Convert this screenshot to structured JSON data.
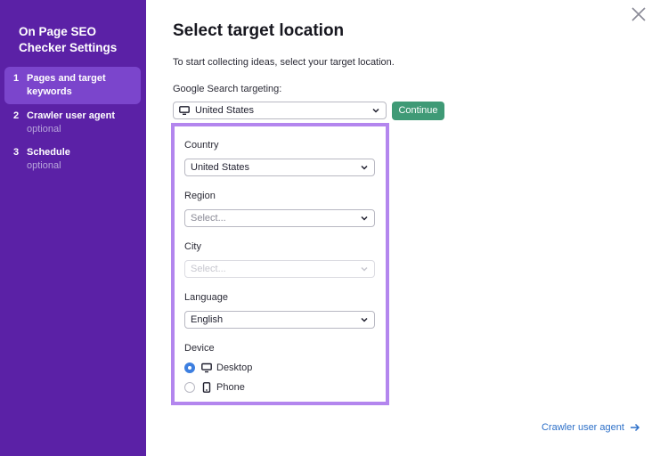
{
  "sidebar": {
    "title": "On Page SEO Checker Settings",
    "steps": [
      {
        "num": "1",
        "label": "Pages and target keywords",
        "sub": ""
      },
      {
        "num": "2",
        "label": "Crawler user agent",
        "sub": "optional"
      },
      {
        "num": "3",
        "label": "Schedule",
        "sub": "optional"
      }
    ]
  },
  "main": {
    "title": "Select target location",
    "subtitle": "To start collecting ideas, select your target location.",
    "targeting_label": "Google Search targeting:",
    "targeting_value": "United States",
    "continue_label": "Continue",
    "country": {
      "label": "Country",
      "value": "United States"
    },
    "region": {
      "label": "Region",
      "placeholder": "Select..."
    },
    "city": {
      "label": "City",
      "placeholder": "Select..."
    },
    "language": {
      "label": "Language",
      "value": "English"
    },
    "device": {
      "label": "Device",
      "options": [
        {
          "label": "Desktop",
          "selected": true,
          "icon": "desktop-icon"
        },
        {
          "label": "Phone",
          "selected": false,
          "icon": "phone-icon"
        }
      ]
    },
    "next_link": "Crawler user agent"
  },
  "colors": {
    "sidebar_bg": "#5b21a6",
    "active_step_bg": "#7b45cc",
    "continue_bg": "#3f9a76",
    "panel_border": "#b386ee",
    "link": "#2c6fc8",
    "radio_checked": "#3d7fe0"
  }
}
